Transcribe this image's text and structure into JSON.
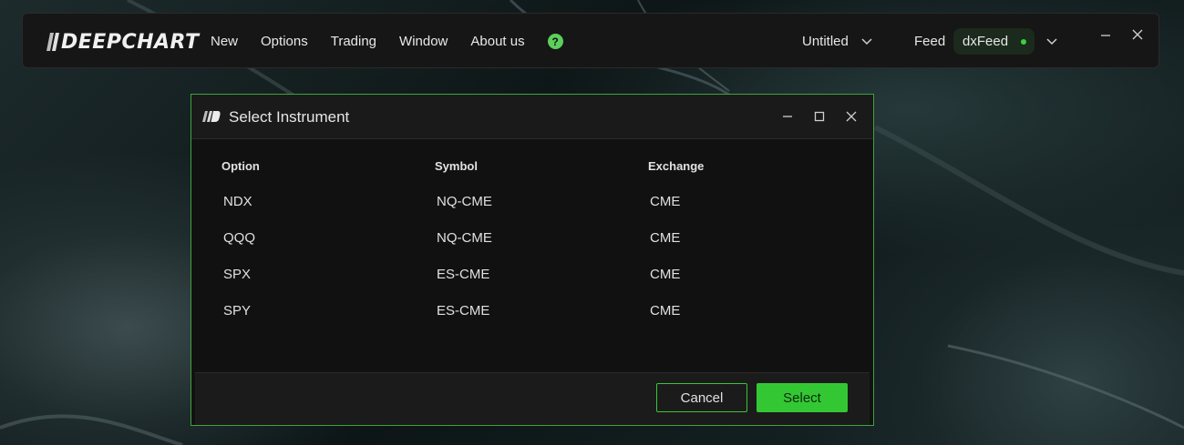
{
  "app": {
    "logo_text": "DEEPCHART"
  },
  "menu": {
    "items": [
      "New",
      "Options",
      "Trading",
      "Window",
      "About us"
    ]
  },
  "workspace": {
    "label": "Untitled"
  },
  "feed": {
    "label": "Feed",
    "name": "dxFeed",
    "status_color": "#3bd13b"
  },
  "dialog": {
    "title": "Select Instrument",
    "columns": [
      "Option",
      "Symbol",
      "Exchange"
    ],
    "rows": [
      {
        "option": "NDX",
        "symbol": "NQ-CME",
        "exchange": "CME"
      },
      {
        "option": "QQQ",
        "symbol": "NQ-CME",
        "exchange": "CME"
      },
      {
        "option": "SPX",
        "symbol": "ES-CME",
        "exchange": "CME"
      },
      {
        "option": "SPY",
        "symbol": "ES-CME",
        "exchange": "CME"
      }
    ],
    "cancel_label": "Cancel",
    "select_label": "Select"
  },
  "colors": {
    "accent": "#33c833",
    "dialog_border": "#3fa33f"
  }
}
